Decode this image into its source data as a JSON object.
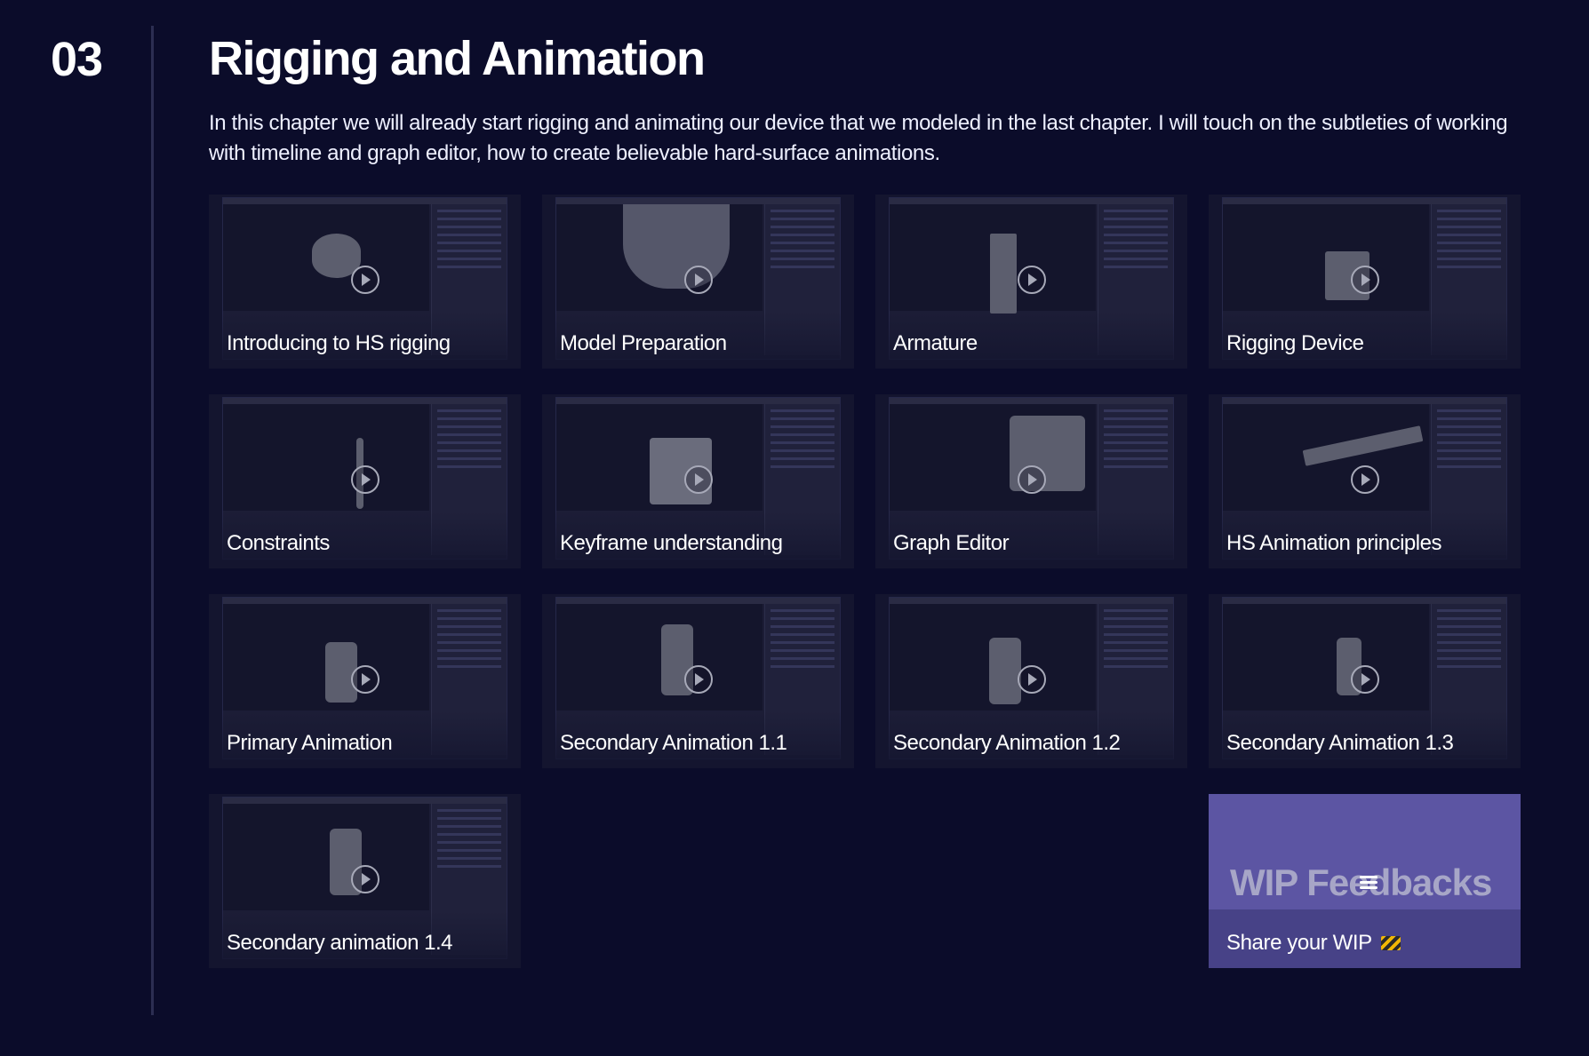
{
  "chapter": {
    "number": "03",
    "title": "Rigging and Animation",
    "description": "In this chapter we will already start rigging and animating our device that we modeled in the last chapter. I will touch on the subtleties of working with timeline and graph editor, how to create believable hard-surface animations."
  },
  "lessons": [
    {
      "label": "Introducing to HS rigging"
    },
    {
      "label": "Model Preparation"
    },
    {
      "label": "Armature"
    },
    {
      "label": "Rigging Device"
    },
    {
      "label": "Constraints"
    },
    {
      "label": "Keyframe understanding"
    },
    {
      "label": "Graph Editor"
    },
    {
      "label": "HS Animation principles"
    },
    {
      "label": "Primary Animation"
    },
    {
      "label": "Secondary Animation 1.1"
    },
    {
      "label": "Secondary Animation 1.2"
    },
    {
      "label": "Secondary Animation 1.3"
    },
    {
      "label": "Secondary animation 1.4"
    }
  ],
  "wip": {
    "title": "WIP Feedbacks",
    "subtitle": "Share your WIP",
    "icon": "construction-barrier-icon"
  },
  "colors": {
    "background": "#0b0c2a",
    "card": "#14152f",
    "wip_accent": "#5c55a3"
  }
}
